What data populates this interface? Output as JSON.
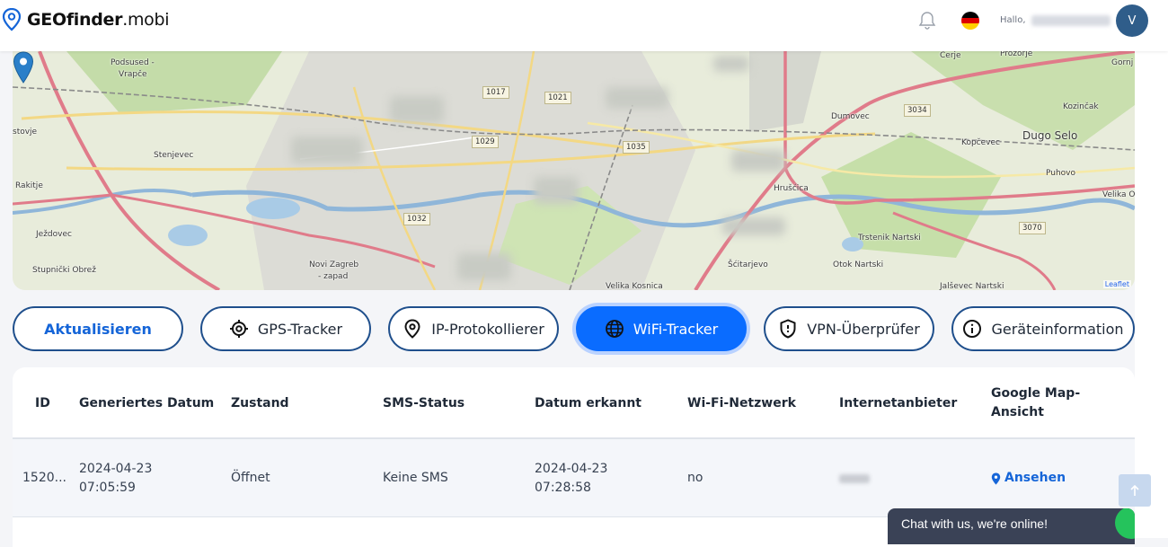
{
  "brand": {
    "name_bold": "GEOfinder",
    "name_thin": ".mobi"
  },
  "header": {
    "greeting": "Hallo,",
    "avatar_initial": "V",
    "flag_colors": [
      "#000000",
      "#dd0000",
      "#ffce00"
    ]
  },
  "map": {
    "labels": {
      "podsused": "Podsused -",
      "vrapce": "Vrapče",
      "stenjevec": "Stenjevec",
      "rakitje": "Rakitje",
      "stovje": "stovje",
      "jezdovec": "Ježdovec",
      "stupnicki": "Stupnički Obrež",
      "novizagreb": "Novi Zagreb",
      "zapad": "- zapad",
      "cerje": "Cerje",
      "prozorje": "Prozorje",
      "gornj": "Gornj",
      "dumovec": "Dumovec",
      "kozincak": "Kozinčak",
      "kopcevec": "Kopčevec",
      "dugoselo": "Dugo Selo",
      "hruscica": "Hrušćica",
      "puhovo": "Puhovo",
      "velikaos": "Velika Os",
      "trstenik": "Trstenik Nartski",
      "otok": "Otok Nartski",
      "scitarjevo": "Šćitarjevo",
      "jalsevec": "Jalševec Nartski",
      "velikakosnica": "Velika Kosnica"
    },
    "badges": {
      "b1017": "1017",
      "b1021": "1021",
      "b1029": "1029",
      "b1035": "1035",
      "b1032": "1032",
      "b3034": "3034",
      "b3070": "3070"
    },
    "attribution": "Leaflet"
  },
  "actions": {
    "refresh": "Aktualisieren",
    "gps": "GPS-Tracker",
    "ip": "IP-Protokollierer",
    "wifi": "WiFi-Tracker",
    "vpn": "VPN-Überprüfer",
    "device": "Geräteinformation"
  },
  "table": {
    "headers": {
      "id": "ID",
      "generated": "Generiertes Datum",
      "state": "Zustand",
      "sms": "SMS-Status",
      "detected": "Datum erkannt",
      "wifi": "Wi-Fi-Netzwerk",
      "isp": "Internetanbieter",
      "gmap1": "Google Map-",
      "gmap2": "Ansicht"
    },
    "rows": [
      {
        "id": "1520...",
        "gen_date": "2024-04-23",
        "gen_time": "07:05:59",
        "state": "Öffnet",
        "sms": "Keine SMS",
        "det_date": "2024-04-23",
        "det_time": "07:28:58",
        "wifi": "no",
        "view": "Ansehen"
      }
    ]
  },
  "chat": {
    "text": "Chat with us, we're online!"
  },
  "colors": {
    "accent": "#0a6cff",
    "button_border": "#1f4f8c",
    "link": "#1565d8"
  }
}
